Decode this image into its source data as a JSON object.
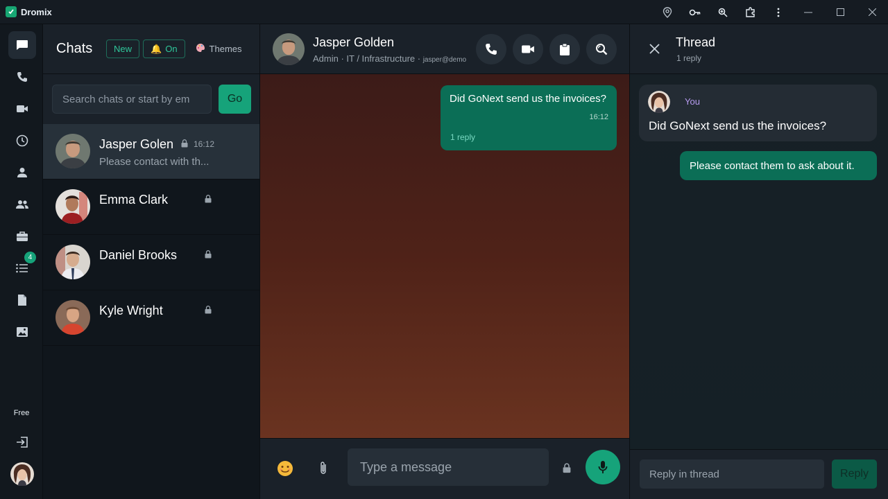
{
  "window": {
    "title": "Dromix",
    "toolbar_icons": [
      "location-pin-icon",
      "key-icon",
      "zoom-icon",
      "extensions-icon",
      "more-vertical-icon"
    ],
    "controls": [
      "minimize-icon",
      "maximize-icon",
      "close-icon"
    ]
  },
  "rail": {
    "items": [
      "chat-icon",
      "phone-icon",
      "video-icon",
      "clock-icon",
      "contact-icon",
      "group-icon",
      "briefcase-icon",
      "list-icon",
      "document-icon",
      "image-icon"
    ],
    "list_badge": "4",
    "plan": "Free",
    "bottom": [
      "logout-icon",
      "user-avatar"
    ]
  },
  "chats": {
    "title": "Chats",
    "new_label": "New",
    "notify_label": "On",
    "themes_label": "Themes",
    "search_placeholder": "Search chats or start by em",
    "go_label": "Go",
    "items": [
      {
        "name": "Jasper Golen",
        "time": "16:12",
        "preview": "Please contact with th...",
        "selected": true
      },
      {
        "name": "Emma Clark",
        "time": "",
        "preview": ""
      },
      {
        "name": "Daniel Brooks",
        "time": "",
        "preview": ""
      },
      {
        "name": "Kyle Wright",
        "time": "",
        "preview": ""
      }
    ]
  },
  "conversation": {
    "name": "Jasper Golden",
    "subtitle": "Admin · IT / Infrastructure · ",
    "email": "jasper@demo",
    "messages": [
      {
        "text": "Did GoNext send us the invoices?",
        "time": "16:12",
        "replies": "1 reply"
      }
    ],
    "composer_placeholder": "Type a message"
  },
  "thread": {
    "title": "Thread",
    "count": "1 reply",
    "root": {
      "author": "You",
      "text": "Did GoNext send us the invoices?"
    },
    "reply": {
      "text": "Please contact them to ask about it."
    },
    "input_placeholder": "Reply in thread",
    "reply_label": "Reply"
  },
  "colors": {
    "accent": "#16a37a",
    "bubble_out": "#0b6e56",
    "author": "#b79cf0"
  }
}
